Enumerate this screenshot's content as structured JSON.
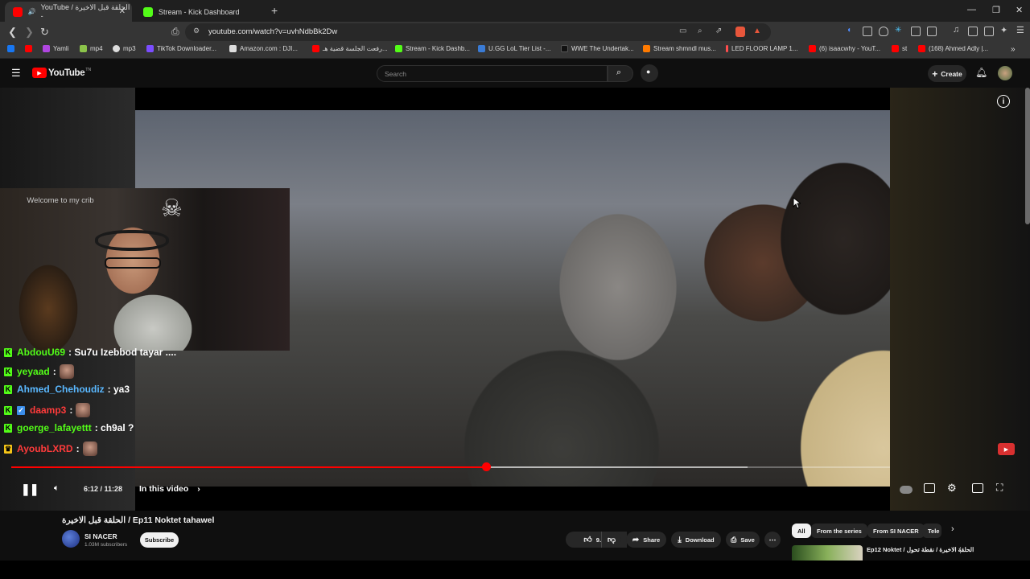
{
  "browser": {
    "tabs": [
      {
        "title": "YouTube / الحلقة قبل الاخيرة -",
        "icon": "youtube-icon",
        "color": "#ff0000"
      },
      {
        "title": "Stream - Kick Dashboard",
        "icon": "kick-icon",
        "color": "#53fc18"
      }
    ],
    "url": "youtube.com/watch?v=uvhNdbBk2Dw",
    "bookmarks": [
      {
        "label": "",
        "icon": "facebook-icon",
        "color": "#1877f2"
      },
      {
        "label": "",
        "icon": "youtube-icon",
        "color": "#ff0000"
      },
      {
        "label": "Yamli",
        "icon": "yamli-icon",
        "color": "#b046e0"
      },
      {
        "label": "mp4",
        "icon": "mp4-icon",
        "color": "#8bc34a"
      },
      {
        "label": "mp3",
        "icon": "mp3-icon",
        "color": "#dddddd"
      },
      {
        "label": "TikTok Downloader...",
        "icon": "tiktok-icon",
        "color": "#7b4dff"
      },
      {
        "label": "Amazon.com : DJI...",
        "icon": "amazon-icon",
        "color": "#dddddd"
      },
      {
        "label": "رفعت الجلسة قضية هـ...",
        "icon": "youtube-icon",
        "color": "#ff0000"
      },
      {
        "label": "Stream - Kick Dashb...",
        "icon": "kick-icon",
        "color": "#53fc18"
      },
      {
        "label": "U.GG LoL Tier List -...",
        "icon": "ugg-icon",
        "color": "#3a7bd5"
      },
      {
        "label": "WWE The Undertak...",
        "icon": "wwe-icon",
        "color": "#111111"
      },
      {
        "label": "Stream shmndl mus...",
        "icon": "stream-icon",
        "color": "#ff7a00"
      },
      {
        "label": "LED FLOOR LAMP 1...",
        "icon": "lamp-icon",
        "color": "#ff4d4d"
      },
      {
        "label": "(6) isaacwhy - YouT...",
        "icon": "youtube-icon",
        "color": "#ff0000"
      },
      {
        "label": "st",
        "icon": "youtube-icon",
        "color": "#ff0000"
      },
      {
        "label": "(168) Ahmed Adly |...",
        "icon": "youtube-icon",
        "color": "#ff0000"
      }
    ]
  },
  "youtube": {
    "logo_text": "YouTube",
    "logo_sup": "TN",
    "search_placeholder": "Search",
    "create_label": "Create"
  },
  "overlay": {
    "webcam_text": "Welcome to my crib",
    "chat": [
      {
        "user": "AbdouU69",
        "message": ": Su7u Izebbod tayar ....",
        "color": "#53fc18",
        "emote": false
      },
      {
        "user": "yeyaad",
        "message": ":",
        "color": "#53fc18",
        "emote": true
      },
      {
        "user": "Ahmed_Chehoudiz",
        "message": ": ya3",
        "color": "#5ab8ff",
        "emote": false
      },
      {
        "user": "daamp3",
        "message": ":",
        "color": "#ff3b3b",
        "emote": true
      },
      {
        "user": "goerge_lafayettt",
        "message": ": ch9al ?",
        "color": "#53fc18",
        "emote": false
      },
      {
        "user": "AyoubLXRD",
        "message": ":",
        "color": "#ff3b3b",
        "emote": true
      }
    ]
  },
  "player": {
    "current_time": "6:12",
    "duration": "11:28",
    "time_display": "6:12 / 11:28",
    "progress_fraction": 0.541,
    "chapter_label": "In this video"
  },
  "video_info": {
    "title": "الحلقة قبل الاخيرة / Ep11 Noktet tahawel",
    "channel": "SI NACER",
    "subscribers": "1.03M subscribers",
    "subscribe_label": "Subscribe",
    "likes": "9.6K",
    "share_label": "Share",
    "download_label": "Download",
    "save_label": "Save"
  },
  "chips": [
    "All",
    "From the series",
    "From SI NACER",
    "Tele"
  ],
  "next_video_title": "Ep12 Noktet / الحلقة الاخيرة / نقطة تحول"
}
